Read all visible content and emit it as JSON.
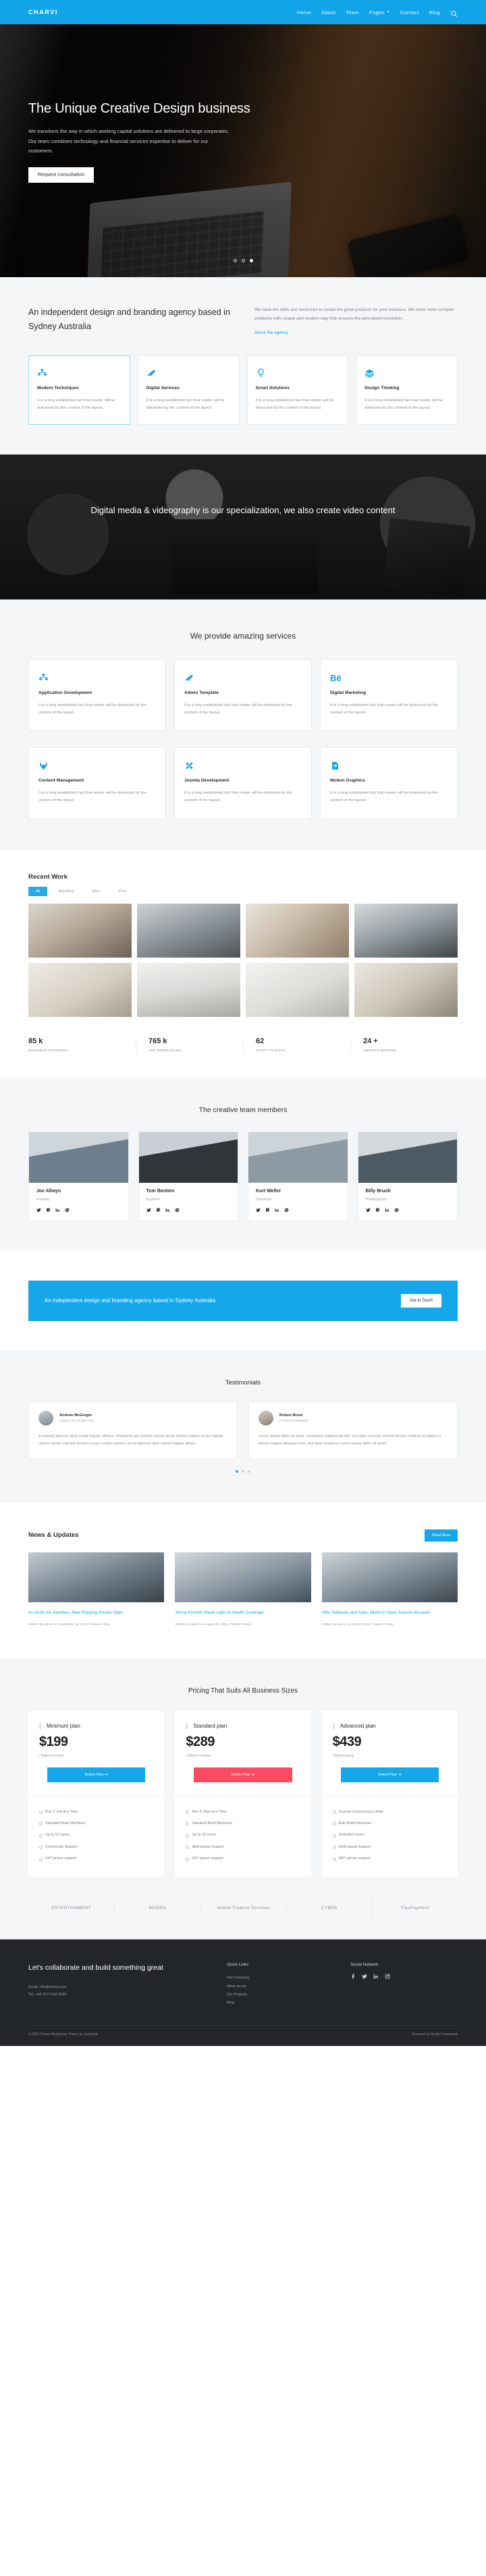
{
  "header": {
    "brand": "CHARVI",
    "nav": [
      {
        "label": "Home",
        "caret": false
      },
      {
        "label": "About",
        "caret": false
      },
      {
        "label": "Team",
        "caret": false
      },
      {
        "label": "Pages",
        "caret": true
      },
      {
        "label": "Contact",
        "caret": false
      },
      {
        "label": "Blog",
        "caret": false
      }
    ],
    "search_icon": "search-icon"
  },
  "hero": {
    "title": "The Unique Creative Design business",
    "subtitle": "We transform the way in which working capital solutions are delivered to large corporates. Our team combines technology and financial services expertise to deliver for our customers.",
    "button": "Request consultation",
    "slides": 3,
    "active_slide": 3
  },
  "intro": {
    "heading": "An independent design and branding agency based in Sydney Australia",
    "paragraph": "We have the skills and resources to create the great products for your business. We solve more complex problems with unique and modern way that ensures the permanent resolution.",
    "link": "About the agency"
  },
  "features": [
    {
      "icon": "cubes-icon",
      "title": "Modern Techniques",
      "desc": "It is a long established fact that reader will be distracted by the content of the layout.",
      "active": true
    },
    {
      "icon": "angular-icon",
      "title": "Digital Services",
      "desc": "It is a long established fact that reader will be distracted by the content of the layout.",
      "active": false
    },
    {
      "icon": "lightbulb-icon",
      "title": "Smart Solutions",
      "desc": "It is a long established fact that reader will be distracted by the content of the layout.",
      "active": false
    },
    {
      "icon": "layers-icon",
      "title": "Design Thinking",
      "desc": "It is a long established fact that reader will be distracted by the content of the layout.",
      "active": false
    }
  ],
  "video_band": {
    "text": "Digital media & videography is our specialization, we also create video content"
  },
  "services": {
    "heading": "We provide amazing services",
    "items": [
      {
        "icon": "cubes-icon",
        "title": "Application Development",
        "desc": "It is a long established fact that reader will be distracted by the content of the layout."
      },
      {
        "icon": "angular-icon",
        "title": "Admin Template",
        "desc": "It is a long established fact that reader will be distracted by the content of the layout."
      },
      {
        "icon": "behance-icon",
        "title": "Digital Marketing",
        "desc": "It is a long established fact that reader will be distracted by the content of the layout."
      },
      {
        "icon": "gitlab-icon",
        "title": "Content Management",
        "desc": "It is a long established fact that reader will be distracted by the content of the layout."
      },
      {
        "icon": "joomla-icon",
        "title": "Joomla Development",
        "desc": "It is a long established fact that reader will be distracted by the content of the layout."
      },
      {
        "icon": "motion-icon",
        "title": "Motion Graphics",
        "desc": "It is a long established fact that reader will be distracted by the content of the layout."
      }
    ]
  },
  "recent_work": {
    "title": "Recent Work",
    "filters": [
      {
        "label": "All",
        "active": true
      },
      {
        "label": "Branding",
        "active": false
      },
      {
        "label": "Misc",
        "active": false
      },
      {
        "label": "Print",
        "active": false
      }
    ],
    "thumbs": [
      "t1",
      "t2",
      "t3",
      "t4",
      "t5",
      "t6",
      "t7",
      "t8"
    ]
  },
  "stats": [
    {
      "number": "85 k",
      "label": "BUSINESS PARTNERS"
    },
    {
      "number": "765 k",
      "label": "APP DOWNLOADS"
    },
    {
      "number": "62",
      "label": "HAPPY CLIENTS"
    },
    {
      "number": "24 +",
      "label": "AWARDS WINNING"
    }
  ],
  "team": {
    "heading": "The creative team members",
    "members": [
      {
        "name": "Joe Allwyn",
        "role": "Founder",
        "photo": "mp1"
      },
      {
        "name": "Tom Bentien",
        "role": "Engineer",
        "photo": "mp2"
      },
      {
        "name": "Kurt Weller",
        "role": "Developer",
        "photo": "mp3"
      },
      {
        "name": "Billy Brunh",
        "role": "Photographer",
        "photo": "mp4"
      }
    ],
    "socials": [
      "twitter-icon",
      "twitch-icon",
      "linkedin-icon",
      "dribbble-icon"
    ]
  },
  "cta": {
    "text": "An independent design and branding agency based in Sydney Australia",
    "button": "Get In Touch"
  },
  "testimonials": {
    "heading": "Testimonials",
    "items": [
      {
        "name": "Andrew McGregor",
        "role": "Support at Creative Tim",
        "quote": "Eventwell telecom dicta curae fugiats ultrices. Eframums per quidem serum facilis dolores netres eneky fugiats cheers nemle mierobe lecares curare sodias amets.Lot est laborum dolo numes fugiats ultrios."
      },
      {
        "name": "Robert Brust",
        "role": "Freelance Designer",
        "quote": "Lorem ipsum dolor sit amet, consetetur sadipscing elitr, sed diam nonumy eirmod tempor invidunt ut labore et dolore magna aliquyam erat, sed diam voluptua. Lorem ipsum dolor sit amet."
      }
    ],
    "dots": 3,
    "active_dot": 1
  },
  "news": {
    "title": "News & Updates",
    "button": "Read More",
    "items": [
      {
        "photo": "np1",
        "title": "As Arctic Ice Vanishes, New Shipping Routes Open",
        "meta": "Written by admin on September 28, 2021. Posted in Blog"
      },
      {
        "photo": "np2",
        "title": "Jimmy Kimmel Sheds Light on Health Coverage",
        "meta": "Written by admin on August 28, 2021. Posted in Blog"
      },
      {
        "photo": "np3",
        "title": "After Setbacks and Suits, Miami to Open Science Museum",
        "meta": "Written by admin on July 20, 2021. Posted in Blog"
      }
    ]
  },
  "pricing": {
    "heading": "Pricing That Suits All Business Sizes",
    "plans": [
      {
        "name": "Minimum plan",
        "price": "$199",
        "billed": "/ Billed monthly",
        "button": "Select Plan ➜",
        "accent": "blue",
        "features": [
          "Run 1 Job at a Time",
          "Standard Build Machines",
          "Up to 10 Users",
          "Community Support",
          "24/7 phone support"
        ]
      },
      {
        "name": "Standard plan",
        "price": "$289",
        "billed": "/ Billed monthly",
        "button": "Select Plan ➜",
        "accent": "pink",
        "features": [
          "Run 5 Jobs at a Time",
          "Standard Build Machines",
          "Up to 15 Users",
          "Web-based Support",
          "24/7 phone support"
        ]
      },
      {
        "name": "Advanced plan",
        "price": "$439",
        "billed": "/ Billed yearly",
        "button": "Select Plan ➜",
        "accent": "blue",
        "features": [
          "Custom Concurrency Limits",
          "Elite Build Machines",
          "Unlimited Users",
          "Web-based Support",
          "24/7 phone support"
        ]
      }
    ]
  },
  "logos": [
    "ENTERTAINMENT",
    "MODEN",
    "Mobile\nFinance\nServices",
    "CYBER",
    "FlexPayment"
  ],
  "footer": {
    "heading": "Let's collaborate and build something great",
    "email": "Email: info@charvi.com",
    "phone": "Tel: +44 1577 616 6065",
    "quick_links_title": "Quick Links",
    "quick_links": [
      "Our Company",
      "What we do",
      "Our Projects",
      "Blog"
    ],
    "social_title": "Social Network",
    "socials": [
      "facebook-icon",
      "twitter-icon",
      "linkedin-icon",
      "instagram-icon"
    ],
    "copyright": "© 2023 Charvi Wordpress Theme by Joomlaid",
    "credit": "Powered by Zanity Framework"
  }
}
